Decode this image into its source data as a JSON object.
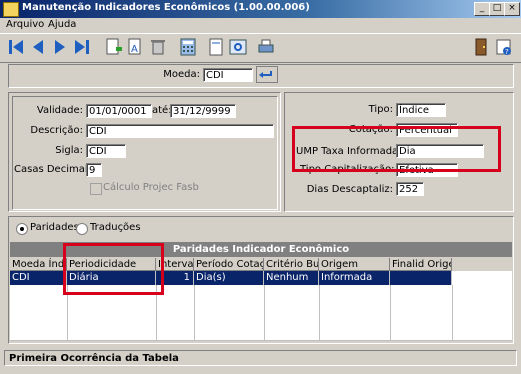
{
  "window": {
    "title": "Manutenção Indicadores Econômicos (1.00.00.006)"
  },
  "menubar": {
    "items": [
      "Arquivo",
      "Ajuda"
    ]
  },
  "toolbar": {
    "icons": [
      "first-icon",
      "prev-icon",
      "next-icon",
      "last-icon",
      "new-record-icon",
      "edit-icon",
      "delete-icon",
      "calculator-icon",
      "document-icon",
      "print-preview-icon",
      "print-icon",
      "exit-icon",
      "help-icon"
    ]
  },
  "moeda": {
    "label": "Moeda:",
    "value": "CDI"
  },
  "form": {
    "validade_label": "Validade:",
    "validade_from": "01/01/0001",
    "ate_label": "até:",
    "validade_to": "31/12/9999",
    "descricao_label": "Descrição:",
    "descricao_value": "CDI",
    "sigla_label": "Sigla:",
    "sigla_value": "CDI",
    "casas_label": "Casas Decimais:",
    "casas_value": "9",
    "calculo_label": "Cálculo Projec Fasb",
    "tipo_label": "Tipo:",
    "tipo_value": "Índice",
    "cotacao_label": "Cotação:",
    "cotacao_value": "Percentual",
    "ump_label": "UMP Taxa Informada:",
    "ump_value": "Dia",
    "tipo_cap_label": "Tipo Capitalização:",
    "tipo_cap_value": "Efetiva",
    "dias_label": "Dias Descaptaliz:",
    "dias_value": "252"
  },
  "tabs": {
    "paridades": "Paridades",
    "traducoes": "Traduções"
  },
  "grid": {
    "title": "Paridades Indicador Econômico",
    "columns": [
      "Moeda Índice",
      "Periodicidade",
      "Intervalo",
      "Período Cotação",
      "Critério Busca",
      "Origem",
      "Finalid Origem"
    ],
    "rows": [
      [
        "CDI",
        "Diária",
        "1",
        "Dia(s)",
        "Nenhum",
        "Informada",
        ""
      ]
    ]
  },
  "status": {
    "text": "Primeira Ocorrência da Tabela"
  },
  "colors": {
    "highlight_box": "#d6001c",
    "selection": "#0a246a",
    "titlebar": "#0a246a"
  }
}
